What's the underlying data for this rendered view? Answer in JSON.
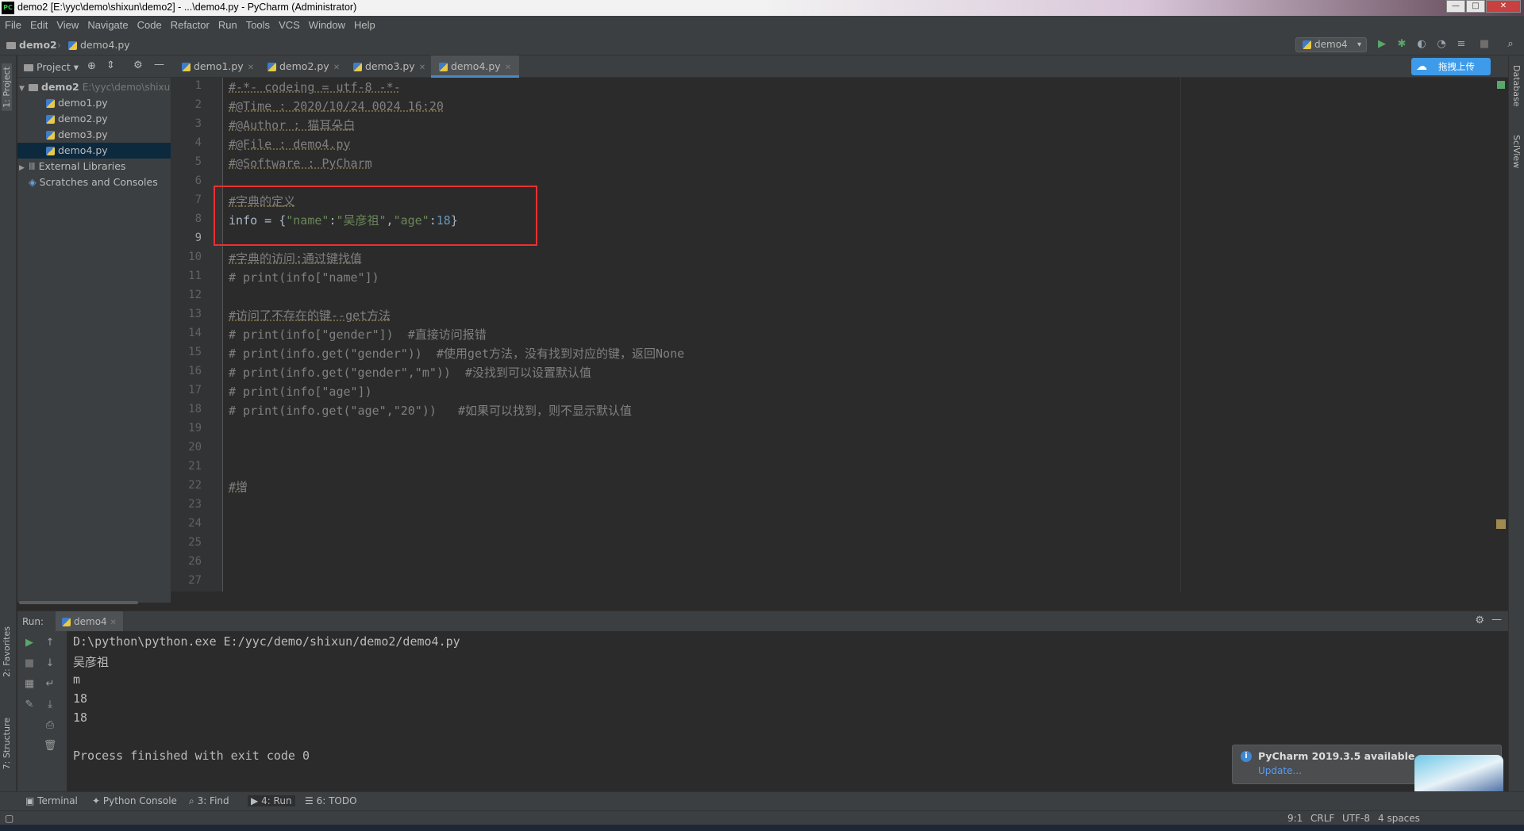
{
  "window": {
    "title": "demo2 [E:\\yyc\\demo\\shixun\\demo2] - ...\\demo4.py - PyCharm (Administrator)",
    "app_icon": "PC"
  },
  "menu": [
    "File",
    "Edit",
    "View",
    "Navigate",
    "Code",
    "Refactor",
    "Run",
    "Tools",
    "VCS",
    "Window",
    "Help"
  ],
  "breadcrumb": {
    "project": "demo2",
    "file": "demo4.py"
  },
  "run_config": "demo4",
  "left_stripe": {
    "project": "1: Project",
    "favorites": "2: Favorites",
    "structure": "7: Structure"
  },
  "right_stripe": {
    "database": "Database",
    "sciview": "SciView"
  },
  "project_panel": {
    "header": "Project",
    "items": [
      {
        "label": "demo2",
        "hint": "E:\\yyc\\demo\\shixun"
      },
      {
        "label": "demo1.py"
      },
      {
        "label": "demo2.py"
      },
      {
        "label": "demo3.py"
      },
      {
        "label": "demo4.py"
      },
      {
        "label": "External Libraries"
      },
      {
        "label": "Scratches and Consoles"
      }
    ]
  },
  "tabs": [
    "demo1.py",
    "demo2.py",
    "demo3.py",
    "demo4.py"
  ],
  "upload_button": "拖拽上传",
  "code": {
    "line_numbers": [
      "1",
      "2",
      "3",
      "4",
      "5",
      "6",
      "7",
      "8",
      "9",
      "10",
      "11",
      "12",
      "13",
      "14",
      "15",
      "16",
      "17",
      "18",
      "19",
      "20",
      "21",
      "22",
      "23",
      "24",
      "25",
      "26",
      "27"
    ],
    "l1": "#-*- codeing = utf-8 -*-",
    "l2": "#@Time : 2020/10/24 0024 16:20",
    "l3": "#@Author : 猫耳朵白",
    "l4": "#@File : demo4.py",
    "l5": "#@Software : PyCharm",
    "l7": "#字典的定义",
    "l8": {
      "a": "info = {",
      "b": "\"name\"",
      "c": ":",
      "d": "\"吴彦祖\"",
      "e": ",",
      "f": "\"age\"",
      "g": ":",
      "h": "18",
      "i": "}"
    },
    "l10": "#字典的访问:通过键找值",
    "l11": "# print(info[\"name\"])",
    "l13": "#访问了不存在的键--get方法",
    "l14": "# print(info[\"gender\"])  #直接访问报错",
    "l15": "# print(info.get(\"gender\"))  #使用get方法，没有找到对应的键，返回None",
    "l16": "# print(info.get(\"gender\",\"m\"))  #没找到可以设置默认值",
    "l17": "# print(info[\"age\"])",
    "l18": "# print(info.get(\"age\",\"20\"))   #如果可以找到，则不显示默认值",
    "l22": "#增"
  },
  "run_panel": {
    "label": "Run:",
    "tab": "demo4",
    "output": [
      "D:\\python\\python.exe E:/yyc/demo/shixun/demo2/demo4.py",
      "吴彦祖",
      "m",
      "18",
      "18",
      "",
      "Process finished with exit code 0"
    ]
  },
  "notification": {
    "title": "PyCharm 2019.3.5 available",
    "link": "Update..."
  },
  "tool_windows": [
    "Terminal",
    "Python Console",
    "3: Find",
    "4: Run",
    "6: TODO"
  ],
  "status": {
    "position": "9:1",
    "line_sep": "CRLF",
    "encoding": "UTF-8",
    "indent": "4 spaces"
  },
  "colors": {
    "accent": "#4a88c7",
    "highlight_box": "#e8312f",
    "string": "#6a8759",
    "number": "#6897bb",
    "comment": "#808080"
  }
}
